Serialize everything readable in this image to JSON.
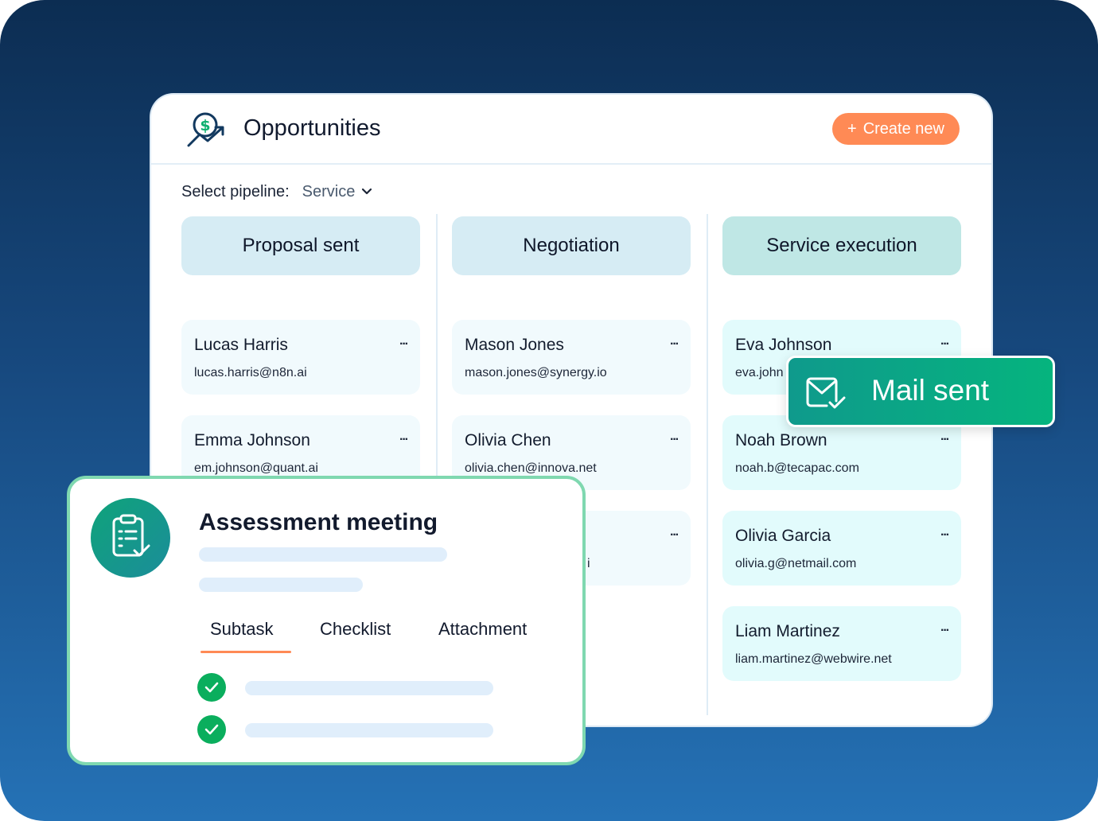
{
  "app": {
    "title": "Opportunities",
    "create_button": {
      "icon": "plus-icon",
      "label": "Create new"
    }
  },
  "pipeline": {
    "label": "Select pipeline:",
    "selected": "Service"
  },
  "columns": [
    {
      "title": "Proposal sent",
      "cards": [
        {
          "name": "Lucas Harris",
          "email": "lucas.harris@n8n.ai"
        },
        {
          "name": "Emma Johnson",
          "email": "em.johnson@quant.ai"
        }
      ]
    },
    {
      "title": "Negotiation",
      "cards": [
        {
          "name": "Mason Jones",
          "email": "mason.jones@synergy.io"
        },
        {
          "name": "Olivia Chen",
          "email": "olivia.chen@innova.net"
        },
        {
          "name": "",
          "email": "i"
        }
      ]
    },
    {
      "title": "Service execution",
      "cards": [
        {
          "name": "Eva Johnson",
          "email": "eva.john"
        },
        {
          "name": "Noah Brown",
          "email": "noah.b@tecapac.com"
        },
        {
          "name": "Olivia Garcia",
          "email": "olivia.g@netmail.com"
        },
        {
          "name": "Liam Martinez",
          "email": "liam.martinez@webwire.net"
        }
      ]
    }
  ],
  "card_menu_glyph": "···",
  "toast": {
    "icon": "mail-check-icon",
    "text": "Mail sent"
  },
  "assessment": {
    "icon": "clipboard-check-icon",
    "title": "Assessment meeting",
    "tabs": [
      "Subtask",
      "Checklist",
      "Attachment"
    ],
    "active_tab": "Subtask"
  },
  "colors": {
    "accent": "#ff8a55",
    "success": "#0aae5d",
    "toast": "#05b47e",
    "stage_header": "#d6ecf4",
    "stage_header_active": "#bfe7e5"
  }
}
